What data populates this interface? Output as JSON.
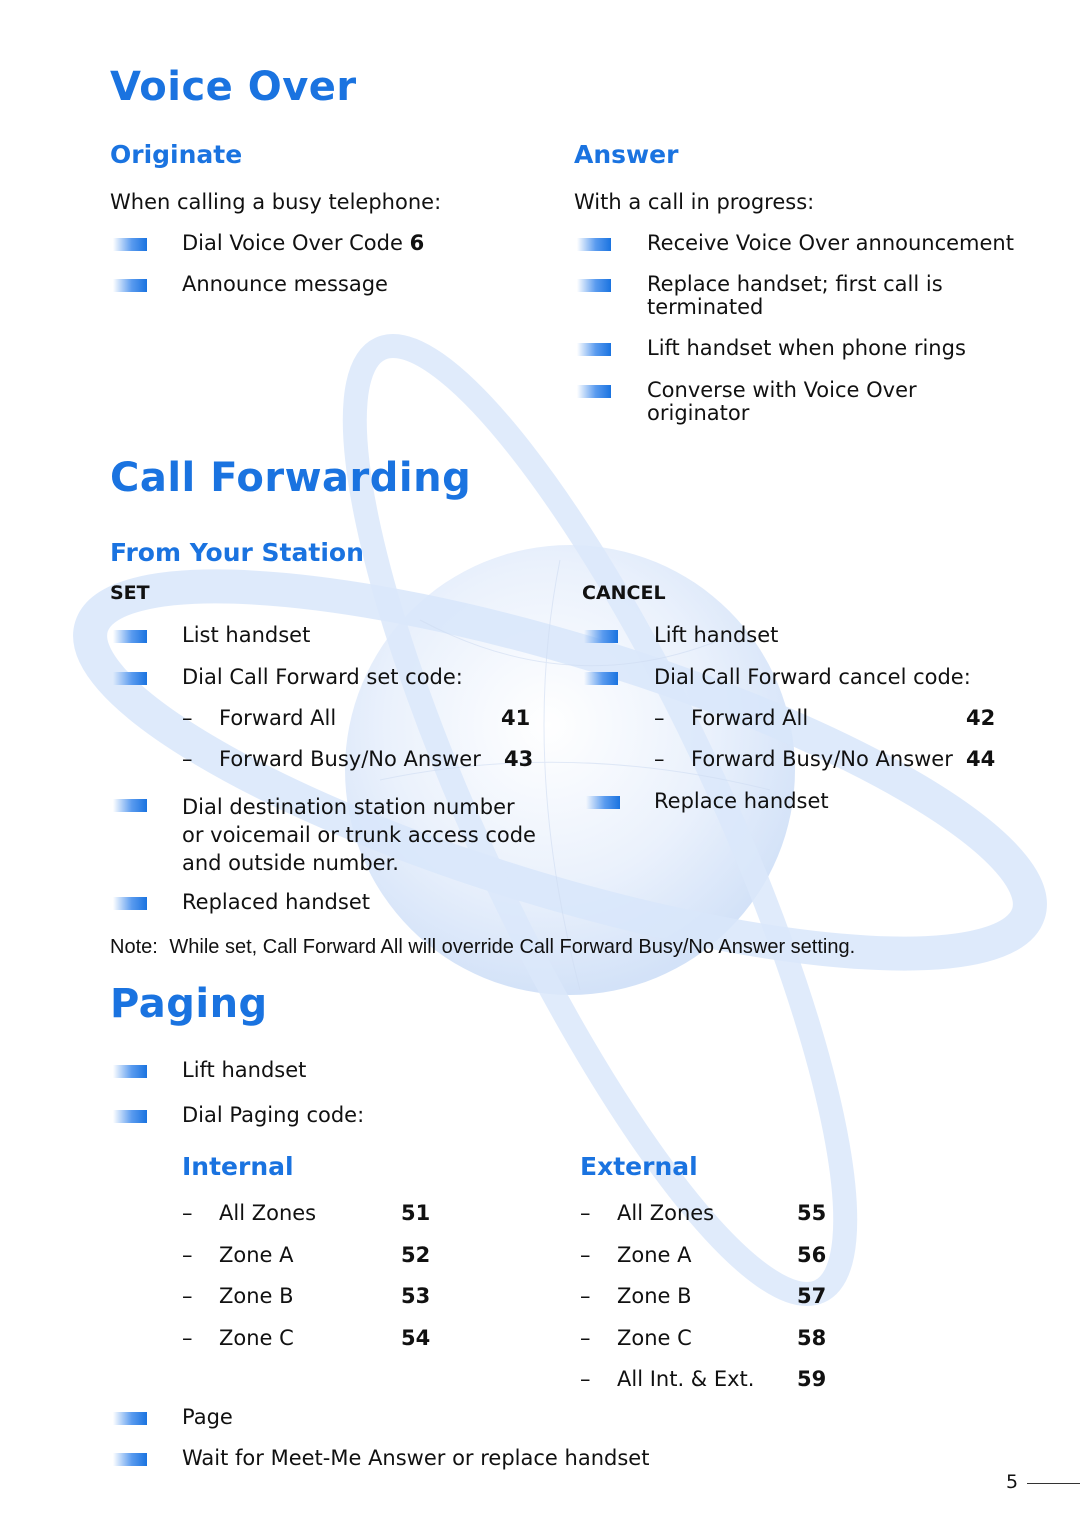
{
  "voice_over": {
    "title": "Voice Over",
    "originate": {
      "heading": "Originate",
      "intro": "When calling a busy telephone:",
      "steps": [
        {
          "text": "Dial Voice Over Code ",
          "code": "6"
        },
        {
          "text": "Announce message"
        }
      ]
    },
    "answer": {
      "heading": "Answer",
      "intro": "With a call in progress:",
      "steps": [
        {
          "line1": "Receive Voice Over announcement"
        },
        {
          "line1": "Replace handset; first call is",
          "line2": "terminated"
        },
        {
          "line1": "Lift handset when phone rings"
        },
        {
          "line1": "Converse with Voice Over",
          "line2": "originator"
        }
      ]
    }
  },
  "call_forwarding": {
    "title": "Call Forwarding",
    "subheading": "From Your Station",
    "set": {
      "label": "SET",
      "steps": [
        "List handset",
        "Dial Call Forward set code:"
      ],
      "codes": [
        {
          "dash": "–",
          "name": "Forward All",
          "code": "41"
        },
        {
          "dash": "–",
          "name": "Forward Busy/No Answer",
          "code": "43"
        }
      ],
      "dial_destination": [
        "Dial destination station number",
        "or voicemail or trunk access code",
        "and outside number."
      ],
      "final_step": "Replaced handset"
    },
    "cancel": {
      "label": "CANCEL",
      "steps": [
        "Lift handset",
        "Dial Call Forward cancel code:"
      ],
      "codes": [
        {
          "dash": "–",
          "name": "Forward All",
          "code": "42"
        },
        {
          "dash": "–",
          "name": "Forward Busy/No Answer",
          "code": "44"
        }
      ],
      "final_step": "Replace handset"
    },
    "note_label": "Note:",
    "note_text": "While set, Call Forward All will override Call Forward Busy/No Answer setting."
  },
  "paging": {
    "title": "Paging",
    "steps": [
      "Lift handset",
      "Dial Paging code:"
    ],
    "internal": {
      "heading": "Internal",
      "rows": [
        {
          "dash": "–",
          "name": "All Zones",
          "code": "51"
        },
        {
          "dash": "–",
          "name": "Zone A",
          "code": "52"
        },
        {
          "dash": "–",
          "name": "Zone B",
          "code": "53"
        },
        {
          "dash": "–",
          "name": "Zone C",
          "code": "54"
        }
      ]
    },
    "external": {
      "heading": "External",
      "rows": [
        {
          "dash": "–",
          "name": "All Zones",
          "code": "55"
        },
        {
          "dash": "–",
          "name": "Zone A",
          "code": "56"
        },
        {
          "dash": "–",
          "name": "Zone B",
          "code": "57"
        },
        {
          "dash": "–",
          "name": "Zone C",
          "code": "58"
        },
        {
          "dash": "–",
          "name": "All Int. & Ext.",
          "code": "59"
        }
      ]
    },
    "final_steps": [
      "Page",
      "Wait for Meet-Me Answer or replace handset"
    ]
  },
  "page_number": "5",
  "colors": {
    "accent": "#1a73e0",
    "text": "#111111",
    "watermark": "#dce8fb"
  }
}
